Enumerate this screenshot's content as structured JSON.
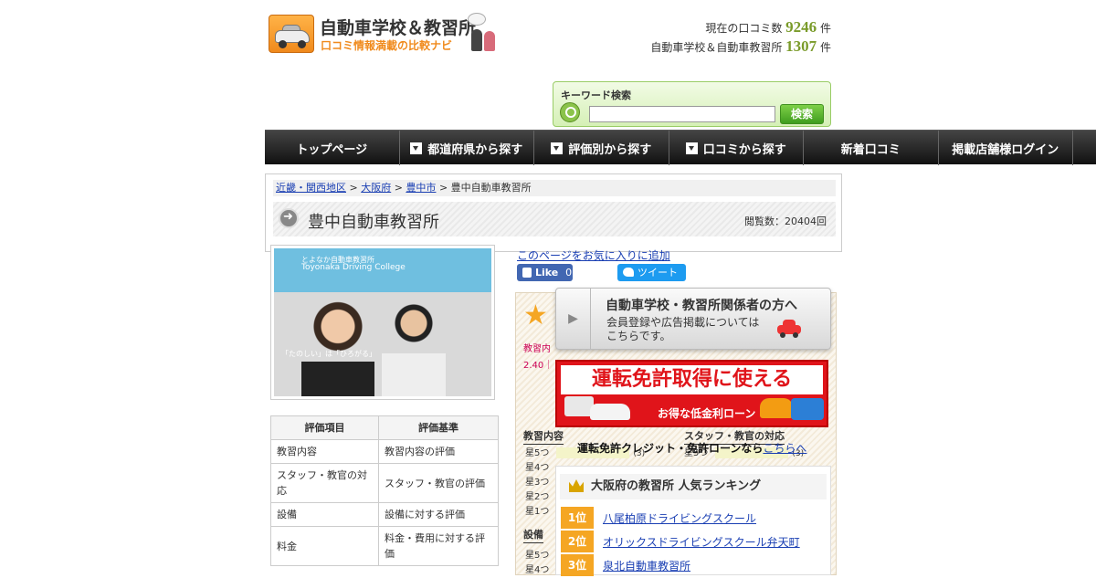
{
  "logo": {
    "title": "自動車学校＆教習所",
    "subtitle": "口コミ情報満載の比較ナビ"
  },
  "counts": {
    "reviews_label": "現在の口コミ数",
    "reviews_value": "9246",
    "reviews_unit": "件",
    "schools_label": "自動車学校＆自動車教習所",
    "schools_value": "1307",
    "schools_unit": "件"
  },
  "search": {
    "label": "キーワード検索",
    "value": "",
    "button": "検索"
  },
  "nav": [
    {
      "label": "トップページ",
      "dropdown": false
    },
    {
      "label": "都道府県から探す",
      "dropdown": true
    },
    {
      "label": "評価別から探す",
      "dropdown": true
    },
    {
      "label": "口コミから探す",
      "dropdown": true
    },
    {
      "label": "新着口コミ",
      "dropdown": false
    },
    {
      "label": "掲載店舗様ログイン",
      "dropdown": false
    }
  ],
  "breadcrumb": {
    "items": [
      "近畿・関西地区",
      "大阪府",
      "豊中市"
    ],
    "current": "豊中自動車教習所"
  },
  "page": {
    "title": "豊中自動車教習所",
    "views": "閲覧数：20404回"
  },
  "photo": {
    "brand_jp": "とよなか自動車教習所",
    "brand_en": "Toyonaka Driving College",
    "caption": "「たのしい」は「ひろがる」"
  },
  "eval_table": {
    "headers": [
      "評価項目",
      "評価基準"
    ],
    "rows": [
      [
        "教習内容",
        "教習内容の評価"
      ],
      [
        "スタッフ・教官の対応",
        "スタッフ・教官の評価"
      ],
      [
        "設備",
        "設備に対する評価"
      ],
      [
        "料金",
        "料金・費用に対する評価"
      ]
    ]
  },
  "social": {
    "favorite": "このページをお気に入りに追加",
    "fb": "Like",
    "fb_count": "0",
    "tw": "ツイート"
  },
  "review": {
    "cat1": "教習内",
    "score1": "2.40｜",
    "col1_title": "教習内容",
    "col2_title": "スタッフ・教官の対応",
    "col1_rows": [
      "星5つ",
      "星4つ",
      "星3つ",
      "星2つ",
      "星1つ"
    ],
    "col1_first_count": "(3)",
    "col2_first": "星5つ",
    "col2_first_count": "(3)",
    "col3_title": "設備",
    "col3_rows": [
      "星5つ",
      "星4つ"
    ]
  },
  "overlay": {
    "title": "自動車学校・教習所関係者の方へ",
    "body1": "会員登録や広告掲載については",
    "body2": "こちらです。"
  },
  "banner": {
    "headline": "運転免許取得に使える",
    "sub": "お得な低金利ローン",
    "text": "運転免許クレジット・免許ローンなら",
    "link": "こちらへ"
  },
  "ranking": {
    "title": "大阪府の教習所 人気ランキング",
    "items": [
      {
        "rank": "1位",
        "name": "八尾柏原ドライビングスクール"
      },
      {
        "rank": "2位",
        "name": "オリックスドライビングスクール弁天町"
      },
      {
        "rank": "3位",
        "name": "泉北自動車教習所"
      }
    ]
  }
}
